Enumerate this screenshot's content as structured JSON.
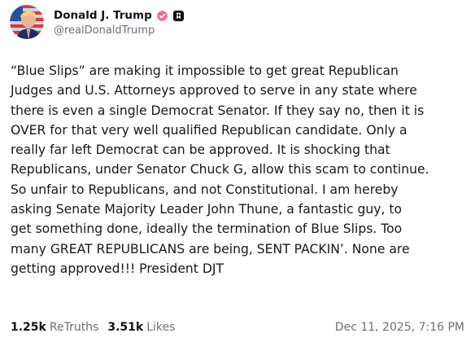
{
  "author": {
    "display_name": "Donald J. Trump",
    "handle": "@realDonaldTrump",
    "verified_icon": "verified-badge-icon",
    "extra_icon": "bookmark-badge-icon",
    "badge_color": "#f06a8f"
  },
  "post": {
    "lines": [
      "“Blue Slips” are making it impossible to get great Republican",
      "Judges and U.S. Attorneys approved to serve in any state where",
      "there is even a single Democrat Senator. If they say no, then it is",
      "OVER for that very well qualified Republican candidate. Only a",
      "really far left Democrat can be approved. It is shocking that",
      "Republicans, under Senator Chuck G, allow this scam to continue.",
      "So unfair to Republicans, and not Constitutional. I am hereby",
      "asking Senate Majority Leader John Thune, a fantastic guy, to",
      "get something done, ideally the termination of Blue Slips. Too",
      "many GREAT REPUBLICANS are being, SENT PACKIN’. None are",
      "getting approved!!! President DJT"
    ]
  },
  "stats": {
    "retruths_count": "1.25k",
    "retruths_label": "ReTruths",
    "likes_count": "3.51k",
    "likes_label": "Likes"
  },
  "timestamp": "Dec 11, 2025, 7:16 PM"
}
